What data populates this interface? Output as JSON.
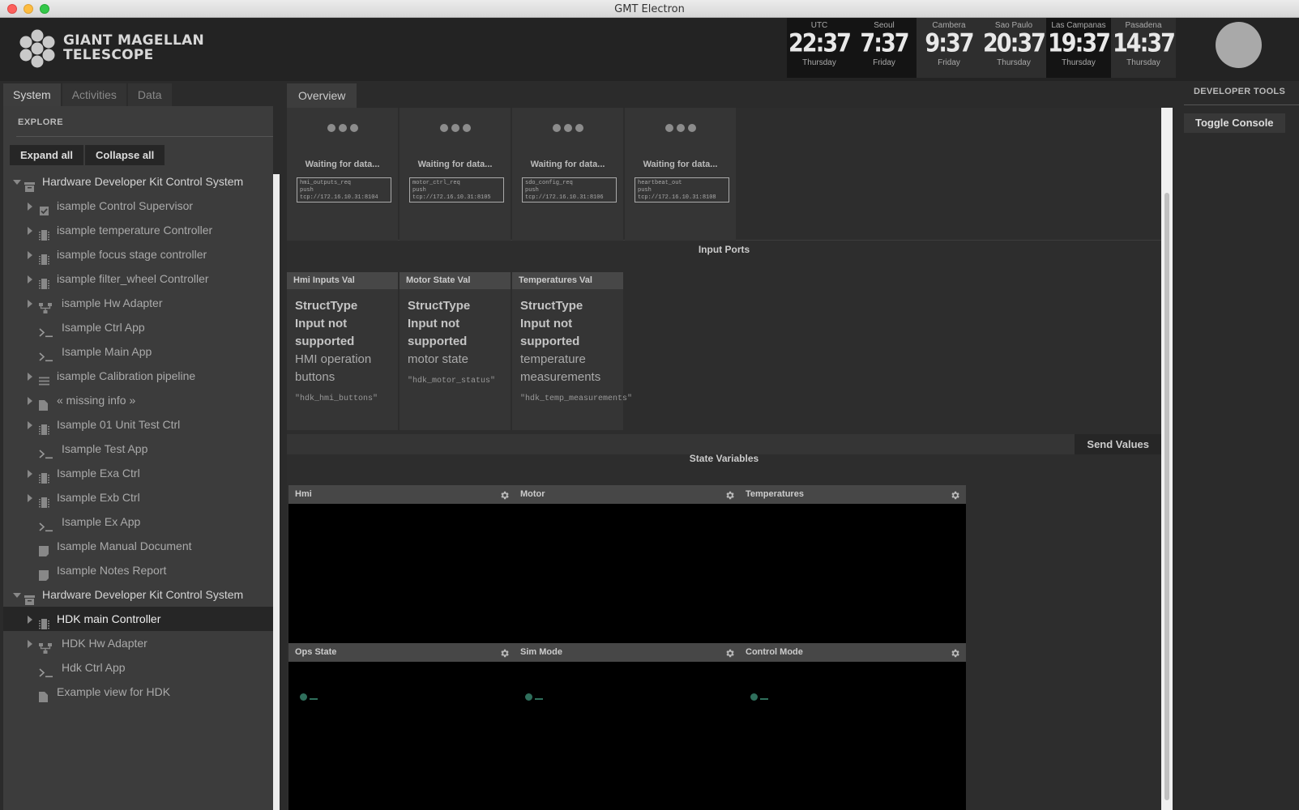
{
  "window": {
    "title": "GMT Electron"
  },
  "header": {
    "logo_line1": "GIANT MAGELLAN",
    "logo_line2": "TELESCOPE",
    "clocks": [
      {
        "city": "UTC",
        "time": "22:37",
        "day": "Thursday",
        "dark": true
      },
      {
        "city": "Seoul",
        "time": "7:37",
        "day": "Friday",
        "dark": true
      },
      {
        "city": "Cambera",
        "time": "9:37",
        "day": "Friday",
        "dark": false
      },
      {
        "city": "Sao Paulo",
        "time": "20:37",
        "day": "Thursday",
        "dark": false
      },
      {
        "city": "Las Campanas",
        "time": "19:37",
        "day": "Thursday",
        "dark": true
      },
      {
        "city": "Pasadena",
        "time": "14:37",
        "day": "Thursday",
        "dark": false
      }
    ]
  },
  "left": {
    "tabs": [
      "System",
      "Activities",
      "Data"
    ],
    "active_tab": "System",
    "explore_label": "EXPLORE",
    "expand_all": "Expand all",
    "collapse_all": "Collapse all",
    "tree": [
      {
        "label": "Hardware Developer Kit Control System",
        "level": 0,
        "caret": "down",
        "icon": "archive-icon",
        "root": true
      },
      {
        "label": "isample Control Supervisor",
        "level": 1,
        "caret": "right",
        "icon": "checkbox-icon"
      },
      {
        "label": "isample temperature Controller",
        "level": 1,
        "caret": "right",
        "icon": "chip-icon"
      },
      {
        "label": "isample focus stage controller",
        "level": 1,
        "caret": "right",
        "icon": "chip-icon"
      },
      {
        "label": "isample filter_wheel Controller",
        "level": 1,
        "caret": "right",
        "icon": "chip-icon"
      },
      {
        "label": "isample Hw Adapter",
        "level": 1,
        "caret": "right",
        "icon": "network-icon"
      },
      {
        "label": "Isample Ctrl App",
        "level": 1,
        "caret": "",
        "icon": "terminal-icon"
      },
      {
        "label": "Isample Main App",
        "level": 1,
        "caret": "",
        "icon": "terminal-icon"
      },
      {
        "label": "isample Calibration pipeline",
        "level": 1,
        "caret": "right",
        "icon": "list-icon"
      },
      {
        "label": "« missing info »",
        "level": 1,
        "caret": "right",
        "icon": "file-icon"
      },
      {
        "label": "Isample 01 Unit Test Ctrl",
        "level": 1,
        "caret": "right",
        "icon": "chip-icon"
      },
      {
        "label": "Isample Test App",
        "level": 1,
        "caret": "",
        "icon": "terminal-icon"
      },
      {
        "label": "Isample Exa Ctrl",
        "level": 1,
        "caret": "right",
        "icon": "chip-icon"
      },
      {
        "label": "Isample Exb Ctrl",
        "level": 1,
        "caret": "right",
        "icon": "chip-icon"
      },
      {
        "label": "Isample Ex App",
        "level": 1,
        "caret": "",
        "icon": "terminal-icon"
      },
      {
        "label": "Isample Manual Document",
        "level": 1,
        "caret": "",
        "icon": "document-icon"
      },
      {
        "label": "Isample Notes Report",
        "level": 1,
        "caret": "",
        "icon": "document-icon"
      },
      {
        "label": "Hardware Developer Kit Control System",
        "level": 0,
        "caret": "down",
        "icon": "archive-icon",
        "root": true
      },
      {
        "label": "HDK main Controller",
        "level": 1,
        "caret": "right",
        "icon": "chip-icon",
        "selected": true
      },
      {
        "label": "HDK Hw Adapter",
        "level": 1,
        "caret": "right",
        "icon": "network-icon"
      },
      {
        "label": "Hdk Ctrl App",
        "level": 1,
        "caret": "",
        "icon": "terminal-icon"
      },
      {
        "label": "Example view for HDK",
        "level": 1,
        "caret": "",
        "icon": "file-icon"
      }
    ]
  },
  "center": {
    "tab": "Overview",
    "output_ports": [
      {
        "waiting": "Waiting for data...",
        "addr": [
          "hmi_outputs_req",
          "push",
          "tcp://172.16.10.31:8104"
        ]
      },
      {
        "waiting": "Waiting for data...",
        "addr": [
          "motor_ctrl_req",
          "push",
          "tcp://172.16.10.31:8105"
        ]
      },
      {
        "waiting": "Waiting for data...",
        "addr": [
          "sdo_config_req",
          "push",
          "tcp://172.16.10.31:8106"
        ]
      },
      {
        "waiting": "Waiting for data...",
        "addr": [
          "heartbeat_out",
          "push",
          "tcp://172.16.10.31:8108"
        ]
      }
    ],
    "input_ports_title": "Input Ports",
    "input_ports": [
      {
        "title": "Hmi Inputs Val",
        "l1": "StructType",
        "l2": "Input not",
        "l3": "supported",
        "desc": [
          "HMI operation",
          "buttons"
        ],
        "code": "\"hdk_hmi_buttons\""
      },
      {
        "title": "Motor State Val",
        "l1": "StructType",
        "l2": "Input not",
        "l3": "supported",
        "desc": [
          "motor state"
        ],
        "code": "\"hdk_motor_status\""
      },
      {
        "title": "Temperatures Val",
        "l1": "StructType",
        "l2": "Input not",
        "l3": "supported",
        "desc": [
          "temperature",
          "measurements"
        ],
        "code": "\"hdk_temp_measurements\""
      }
    ],
    "send_values": "Send Values",
    "state_vars_title": "State Variables",
    "state_vars_row1": [
      "Hmi",
      "Motor",
      "Temperatures"
    ],
    "state_vars_row2": [
      "Ops State",
      "Sim Mode",
      "Control Mode"
    ]
  },
  "right": {
    "title": "DEVELOPER TOOLS",
    "toggle_console": "Toggle Console"
  },
  "colors": {
    "led": "#2f6f5c",
    "selected_row": "#262626"
  }
}
